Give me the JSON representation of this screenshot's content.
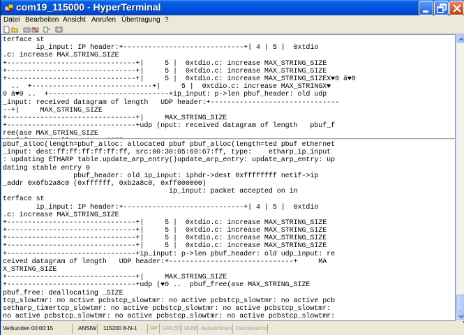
{
  "window": {
    "title": "com19_115000 - HyperTerminal"
  },
  "menu": [
    "Datei",
    "Bearbeiten",
    "Ansicht",
    "Anrufen",
    "Übertragung",
    "?"
  ],
  "toolbar_icons": [
    "new-icon",
    "open-icon",
    "call-icon",
    "disconnect-icon",
    "send-icon",
    "properties-icon"
  ],
  "terminal": {
    "upper_lines": [
      "terface st",
      "        ip_input: IP header:+-----------------------------+| 4 | 5 |  0xtdio",
      ".c: increase MAX_STRING_SIZE",
      "+-------------------------------+|     5 |  0xtdio.c: increase MAX_STRING_SIZE",
      "+-------------------------------+|     5 |  0xtdio.c: increase MAX_STRING_SIZE",
      "+-------------------------------+|     5 |  0xtdio.c: increase MAX_STRING_SIZEX♥0 ä♥0",
      "  ..  +-----------------------------+|     5 |  0xtdio.c: increase MAX_STRINGX♥",
      "0 ä♥0 ..  +-----------------------------+ip_input: p->len pbuf_header: old udp",
      "_input: received datagram of length   UDP header:+-------------------------------",
      "--+|     MAX_STRING_SIZE",
      "+-------------------------------+|     MAX_STRING_SIZE",
      "+-------------------------------+udp (nput: received datagram of length   pbuf_f",
      "ree(ase MAX_STRING_SIZE",
      "pbuf_free: deallocating _SIZE"
    ],
    "lower_lines": [
      "pbuf_alloc(length=pbuf_alloc: allocated pbuf pbuf_alloc(length=ted pbuf ethernet",
      "_input: dest:ff:ff:ff:ff:ff:ff, src:00:30:05:69:67:ff, type:    etharp_ip_input",
      ": updating ETHARP table.update_arp_entry()update_arp_entry: update_arp_entry: up",
      "dating stable entry 0",
      "                 pbuf_header: old ip_input: iphdr->dest 0xffffffff netif->ip",
      "_addr 0x6fb2a8c0 (0xffffff, 0xb2a8c0, 0xff000000)",
      "                                        ip_input: packet accepted on in",
      "terface st",
      "        ip_input: IP header:+-----------------------------+| 4 | 5 |  0xtdio",
      ".c: increase MAX_STRING_SIZE",
      "+-------------------------------+|     5 |  0xtdio.c: increase MAX_STRING_SIZE",
      "+-------------------------------+|     5 |  0xtdio.c: increase MAX_STRING_SIZE",
      "+-------------------------------+|     5 |  0xtdio.c: increase MAX_STRING_SIZE",
      "+-------------------------------+|     5 |  0xtdio.c: increase MAX_STRING_SIZE",
      "+-------------------------------+ip_input: p->len pbuf_header: old udp_input: re",
      "ceived datagram of length   UDP header:+------------------------------+     MA",
      "X_STRING_SIZE",
      "+-------------------------------+|     MAX_STRING_SIZE",
      "+-------------------------------+udp (♥0 ..  pbuf_free(ase MAX_STRING_SIZE",
      "pbuf_free: deallocating _SIZE",
      "tcp_slowtmr: no active pcbstcp_slowtmr: no active pcbstcp_slowtmr: no active pcb",
      "setharp_timertcp_slowtmr: no active pcbstcp_slowtmr: no active pcbstcp_slowtmr:",
      "no active pcbstcp_slowtmr: no active pcbstcp_slowtmr: no active pcbstcp_slowtmr:",
      "no active pcbstcp_slowtmr: no active pcbstcp_slowtmr: no active pcbs"
    ]
  },
  "status": {
    "connected": "Verbunden 00:00:15",
    "emulation": "ANSIW",
    "settings": "115200 8-N-1",
    "rp": "RP",
    "gross": "GROSS",
    "num": "NUM",
    "capture": "Aufzeichnen",
    "echo": "Druckerecho"
  },
  "colors": {
    "titlebar": "#0055e5",
    "chrome": "#ece9d8",
    "terminal_bg": "#ffffff"
  }
}
